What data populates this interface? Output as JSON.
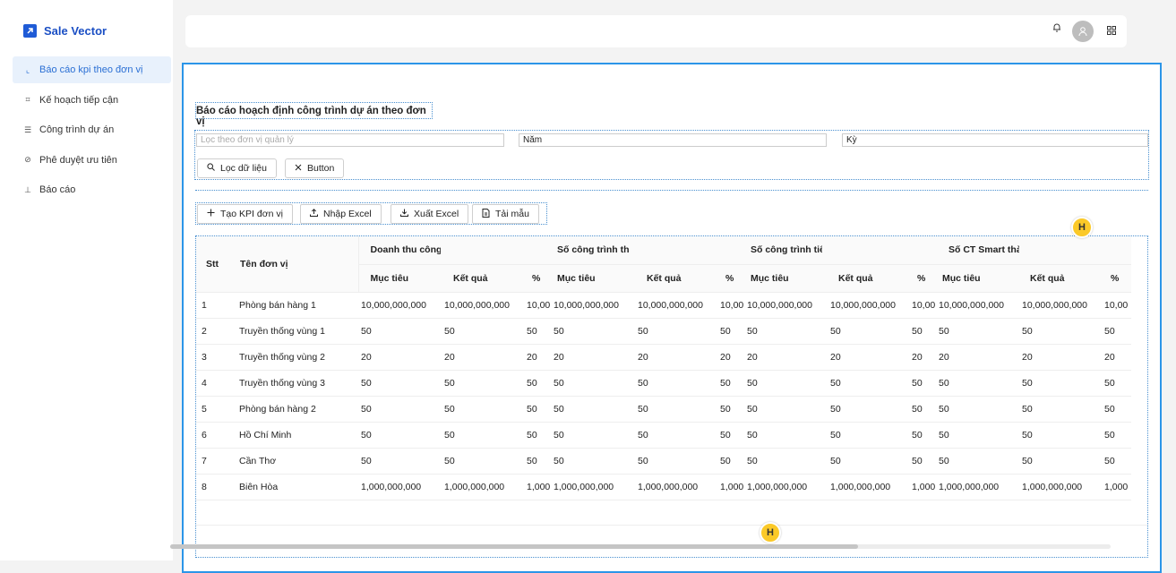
{
  "brand": {
    "name": "Sale Vector"
  },
  "sidebar": {
    "items": [
      {
        "label": "Báo cáo kpi theo đơn vị",
        "icon": "line-chart-icon",
        "glyph": "⌞"
      },
      {
        "label": "Kế hoạch tiếp cận",
        "icon": "nodes-icon",
        "glyph": "⌗"
      },
      {
        "label": "Công trình dự án",
        "icon": "list-icon",
        "glyph": "☰"
      },
      {
        "label": "Phê duyệt ưu tiên",
        "icon": "check-circle-icon",
        "glyph": "⊘"
      },
      {
        "label": "Báo cáo",
        "icon": "bar-chart-icon",
        "glyph": "⊥"
      }
    ]
  },
  "page": {
    "title": "Báo cáo hoạch định công trình dự án theo đơn vị"
  },
  "filters": {
    "unit_placeholder": "Lọc theo đơn vị quản lý",
    "year_value": "Năm",
    "period_value": "Kỳ",
    "filter_button": "Lọc dữ liệu",
    "clear_button": "Button"
  },
  "actions": {
    "create": "Tạo KPI đơn vị",
    "import": "Nhập Excel",
    "export": "Xuất Excel",
    "template": "Tải mẫu"
  },
  "table": {
    "stt_header": "Stt",
    "name_header": "Tên đơn vị",
    "groups": [
      "Doanh thu công t",
      "Số công trình thả",
      "Số công trình tiế",
      "Số CT Smart thà"
    ],
    "sub_headers": [
      "Mục tiêu",
      "Kết quả",
      "%"
    ],
    "rows": [
      {
        "stt": "1",
        "name": "Phòng bán hàng 1",
        "cells": [
          "10,000,000,000",
          "10,000,000,000",
          "10,00",
          "10,000,000,000",
          "10,000,000,000",
          "10,00",
          "10,000,000,000",
          "10,000,000,000",
          "10,00",
          "10,000,000,000",
          "10,000,000,000",
          "10,00"
        ]
      },
      {
        "stt": "2",
        "name": "Truyền thống vùng 1",
        "cells": [
          "50",
          "50",
          "50",
          "50",
          "50",
          "50",
          "50",
          "50",
          "50",
          "50",
          "50",
          "50"
        ]
      },
      {
        "stt": "3",
        "name": "Truyền thống vùng 2",
        "cells": [
          "20",
          "20",
          "20",
          "20",
          "20",
          "20",
          "20",
          "20",
          "20",
          "20",
          "20",
          "20"
        ]
      },
      {
        "stt": "4",
        "name": "Truyền thống vùng 3",
        "cells": [
          "50",
          "50",
          "50",
          "50",
          "50",
          "50",
          "50",
          "50",
          "50",
          "50",
          "50",
          "50"
        ]
      },
      {
        "stt": "5",
        "name": "Phòng bán hàng 2",
        "cells": [
          "50",
          "50",
          "50",
          "50",
          "50",
          "50",
          "50",
          "50",
          "50",
          "50",
          "50",
          "50"
        ]
      },
      {
        "stt": "6",
        "name": "Hồ Chí Minh",
        "cells": [
          "50",
          "50",
          "50",
          "50",
          "50",
          "50",
          "50",
          "50",
          "50",
          "50",
          "50",
          "50"
        ]
      },
      {
        "stt": "7",
        "name": "Cần Thơ",
        "cells": [
          "50",
          "50",
          "50",
          "50",
          "50",
          "50",
          "50",
          "50",
          "50",
          "50",
          "50",
          "50"
        ]
      },
      {
        "stt": "8",
        "name": "Biên Hòa",
        "cells": [
          "1,000,000,000",
          "1,000,000,000",
          "1,000",
          "1,000,000,000",
          "1,000,000,000",
          "1,000",
          "1,000,000,000",
          "1,000,000,000",
          "1,000",
          "1,000,000,000",
          "1,000,000,000",
          "1,000"
        ]
      }
    ]
  },
  "badges": {
    "label": "H"
  },
  "colors": {
    "accent": "#2b95e8",
    "brand": "#1f5bd6",
    "badge": "#fbc928"
  }
}
